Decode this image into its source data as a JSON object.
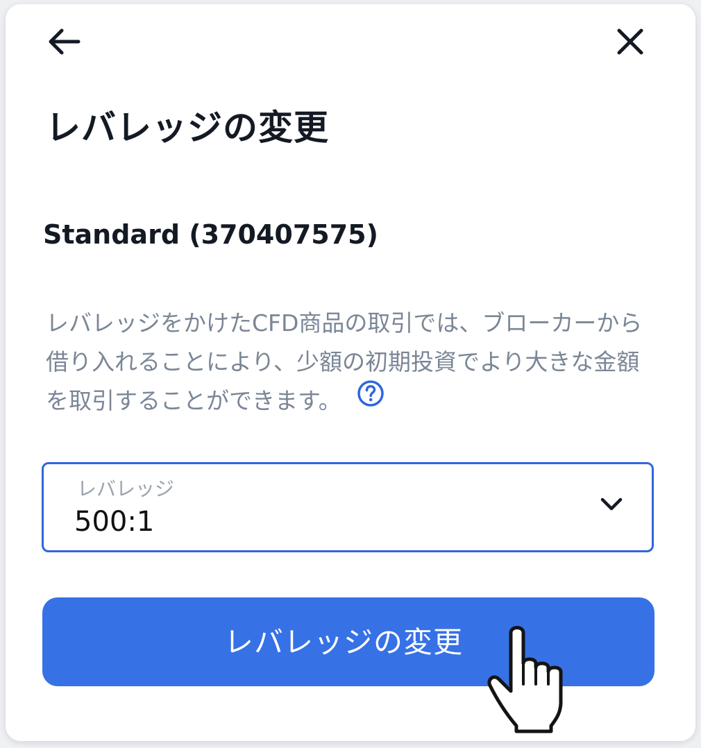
{
  "header": {
    "back_icon": "arrow-left-icon",
    "close_icon": "close-icon"
  },
  "title": "レバレッジの変更",
  "account": {
    "label": "Standard (370407575)"
  },
  "description": {
    "text": "レバレッジをかけたCFD商品の取引では、ブローカーから借り入れることにより、少額の初期投資でより大きな金額を取引することができます。",
    "help_icon": "question-circle-icon"
  },
  "leverage_select": {
    "label": "レバレッジ",
    "value": "500:1",
    "icon": "chevron-down-icon"
  },
  "submit_button": {
    "label": "レバレッジの変更"
  },
  "colors": {
    "accent": "#3671e6",
    "focus_border": "#2f66dd",
    "title_text": "#141a24",
    "muted_text": "#7a8696",
    "label_text": "#9aa3af"
  },
  "cursor": {
    "icon": "hand-pointer-icon"
  }
}
